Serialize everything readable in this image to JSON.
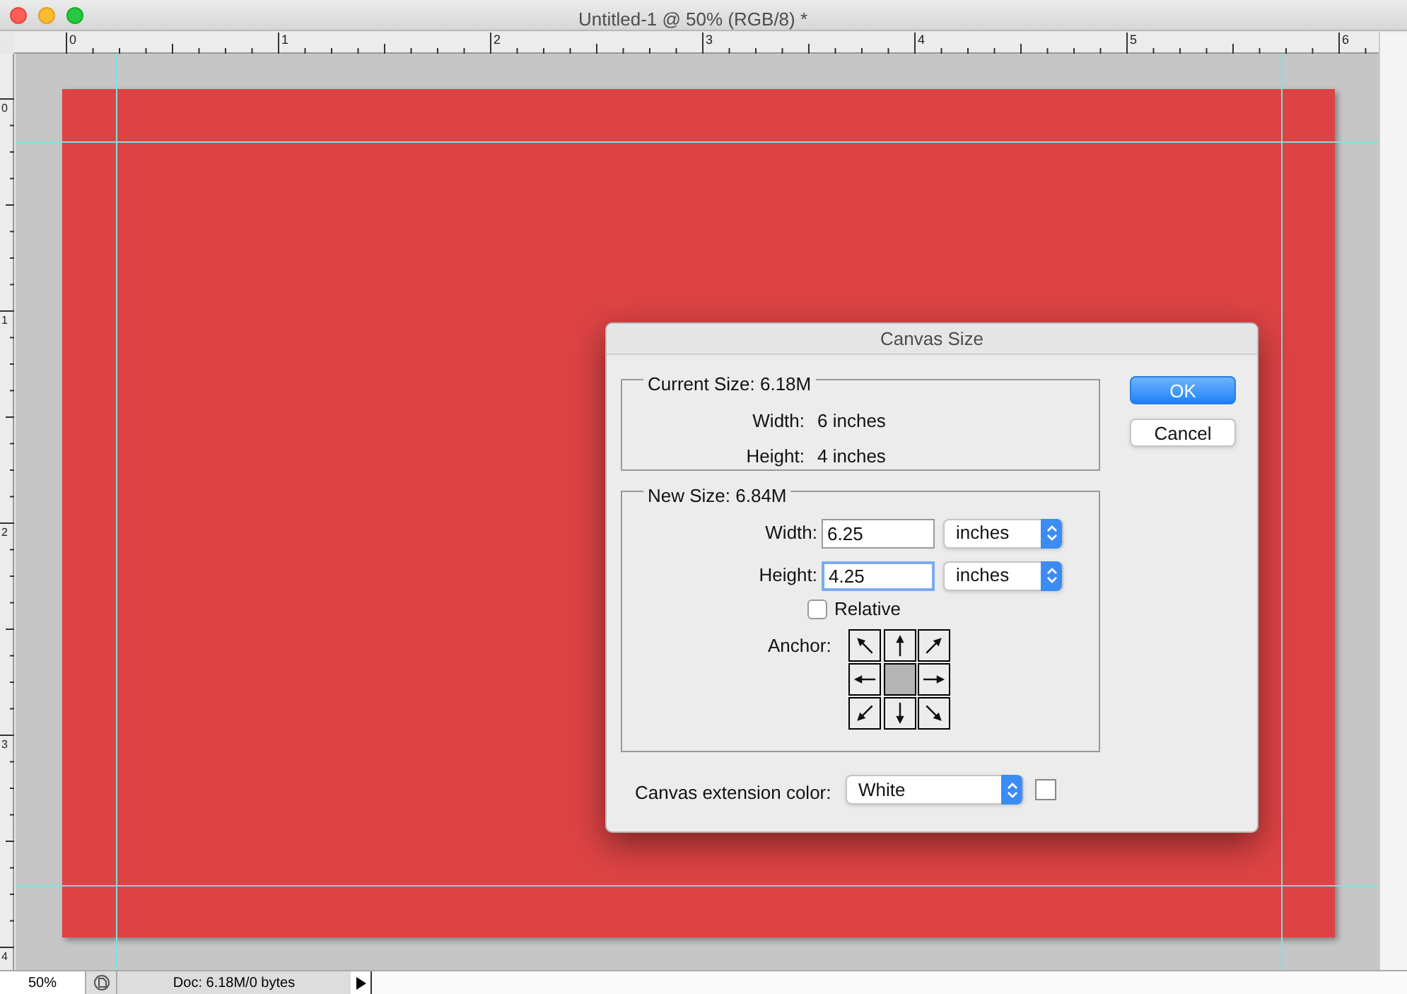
{
  "window": {
    "title": "Untitled-1 @ 50% (RGB/8) *"
  },
  "rulers": {
    "horizontal": [
      "0",
      "1",
      "2",
      "3",
      "4",
      "5",
      "6"
    ],
    "vertical": [
      "0",
      "1",
      "2",
      "3",
      "4"
    ]
  },
  "dialog": {
    "title": "Canvas Size",
    "current_size": {
      "legend": "Current Size: 6.18M",
      "rows": [
        {
          "label": "Width:",
          "value": "6 inches"
        },
        {
          "label": "Height:",
          "value": "4 inches"
        }
      ]
    },
    "new_size": {
      "legend": "New Size: 6.84M",
      "fields": [
        {
          "label": "Width:",
          "value": "6.25",
          "unit": "inches",
          "focused": false
        },
        {
          "label": "Height:",
          "value": "4.25",
          "unit": "inches",
          "focused": true
        }
      ],
      "relative": {
        "label": "Relative",
        "checked": false
      },
      "anchor": {
        "label": "Anchor:",
        "cells": [
          {
            "kind": "nw",
            "selected": false
          },
          {
            "kind": "n",
            "selected": false
          },
          {
            "kind": "ne",
            "selected": false
          },
          {
            "kind": "w",
            "selected": false
          },
          {
            "kind": "center",
            "selected": true
          },
          {
            "kind": "e",
            "selected": false
          },
          {
            "kind": "sw",
            "selected": false
          },
          {
            "kind": "s",
            "selected": false
          },
          {
            "kind": "se",
            "selected": false
          }
        ]
      }
    },
    "extension_color": {
      "label": "Canvas extension color:",
      "value": "White"
    },
    "buttons": [
      {
        "label": "OK",
        "default": true
      },
      {
        "label": "Cancel",
        "default": false
      }
    ]
  },
  "status_bar": {
    "zoom": "50%",
    "doc": "Doc: 6.18M/0 bytes"
  }
}
